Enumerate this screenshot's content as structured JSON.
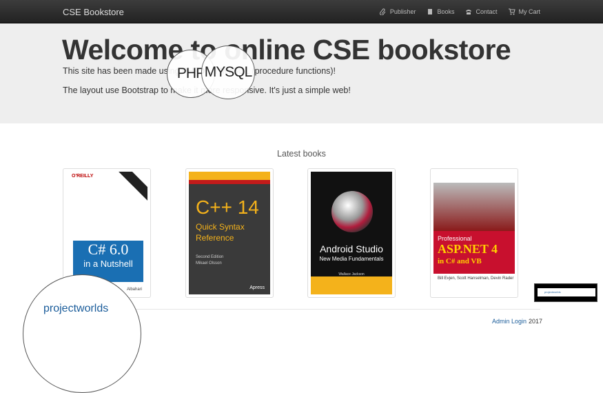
{
  "navbar": {
    "brand": "CSE Bookstore",
    "links": [
      {
        "label": "Publisher",
        "icon": "paperclip-icon"
      },
      {
        "label": "Books",
        "icon": "book-icon"
      },
      {
        "label": "Contact",
        "icon": "phone-icon"
      },
      {
        "label": "My Cart",
        "icon": "cart-icon"
      }
    ]
  },
  "hero": {
    "title": "Welcome to online CSE bookstore",
    "line1": "This site has been made using PHP with MYSQL (procedure functions)!",
    "line2": "The layout use Bootstrap to make it more responsive. It's just a simple web!",
    "bubble_php": "PHP",
    "bubble_mysql": "MYSQL"
  },
  "latest": {
    "heading": "Latest books",
    "books": [
      {
        "publisher": "O'REILLY",
        "title": "C# 6.0",
        "subtitle": "in a Nutshell",
        "author": "Albahari"
      },
      {
        "title": "C++ 14",
        "subtitle": "Quick Syntax Reference",
        "edition": "Second Edition",
        "author": "Mikael Olsson",
        "publisher": "Apress"
      },
      {
        "title": "Android Studio",
        "subtitle": "New Media Fundamentals",
        "author": "Wallace Jackson"
      },
      {
        "label": "Professional",
        "title": "ASP.NET 4",
        "subtitle": "in C# and VB",
        "author": "Bill Evjen, Scott Hanselman, Devin Rader"
      }
    ]
  },
  "footer": {
    "admin_login": "Admin Login",
    "year": "2017",
    "watermark": "projectworlds",
    "mini_label": "projectworlds"
  },
  "colors": {
    "navbar": "#222222",
    "jumbotron": "#eeeeee",
    "link": "#1a5c9a"
  }
}
